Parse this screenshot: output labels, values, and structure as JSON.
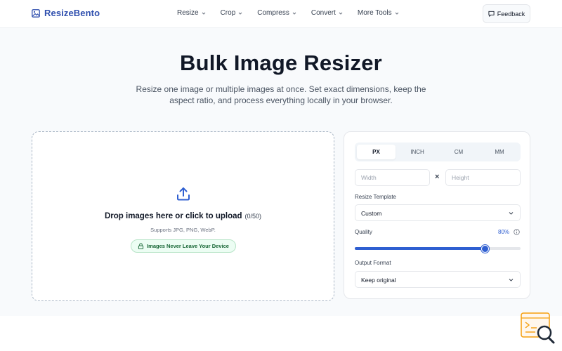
{
  "header": {
    "brand": "ResizeBento",
    "nav": [
      {
        "label": "Resize"
      },
      {
        "label": "Crop"
      },
      {
        "label": "Compress"
      },
      {
        "label": "Convert"
      },
      {
        "label": "More Tools"
      }
    ],
    "feedback_label": "Feedback"
  },
  "hero": {
    "title": "Bulk Image Resizer",
    "subtitle": "Resize one image or multiple images at once. Set exact dimensions, keep the aspect ratio, and process everything locally in your browser."
  },
  "dropzone": {
    "title": "Drop images here or click to upload",
    "count": "(0/50)",
    "formats": "Supports JPG, PNG, WebP.",
    "privacy_badge": "Images Never Leave Your Device"
  },
  "settings": {
    "units": [
      "PX",
      "INCH",
      "CM",
      "MM"
    ],
    "active_unit": "PX",
    "width_placeholder": "Width",
    "height_placeholder": "Height",
    "times_symbol": "×",
    "template_label": "Resize Template",
    "template_value": "Custom",
    "quality_label": "Quality",
    "quality_value": "80%",
    "quality_percent": 80,
    "format_label": "Output Format",
    "format_value": "Keep original"
  },
  "colors": {
    "accent": "#2f5fd1",
    "brand": "#2f4fae",
    "badge_bg": "#ecfdf3",
    "badge_text": "#166534"
  }
}
